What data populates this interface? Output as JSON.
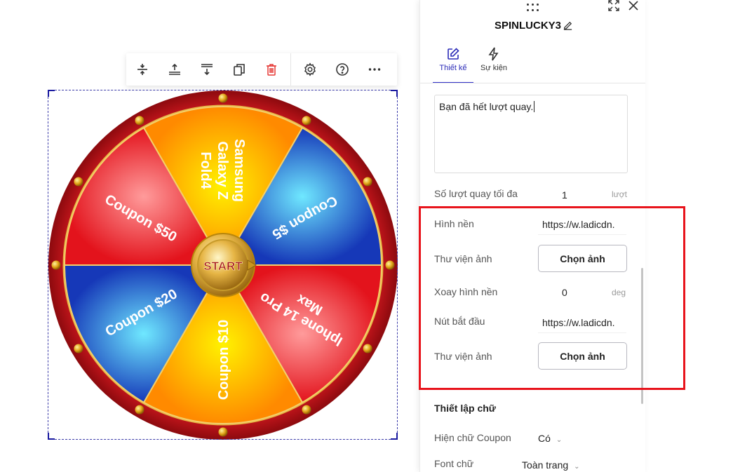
{
  "toolbar": {
    "icons": [
      "align-center-vertical-icon",
      "move-up-icon",
      "move-down-icon",
      "duplicate-icon",
      "delete-icon",
      "settings-icon",
      "help-icon",
      "more-icon"
    ]
  },
  "wheel": {
    "center_label": "START",
    "segments": [
      {
        "label": "Samsung Galaxy Z Fold4",
        "lines": [
          "Samsung",
          "Galaxy Z",
          "Fold4"
        ],
        "color": "#ff9800"
      },
      {
        "label": "Coupon $5",
        "lines": [
          "Coupon $5"
        ],
        "color": "#1e4fc4"
      },
      {
        "label": "Iphone 14 Pro Max",
        "lines": [
          "Iphone 14 Pro",
          "Max"
        ],
        "color": "#e8232a"
      },
      {
        "label": "Coupon $10",
        "lines": [
          "Coupon $10"
        ],
        "color": "#ff9800"
      },
      {
        "label": "Coupon $20",
        "lines": [
          "Coupon $20"
        ],
        "color": "#1e4fc4"
      },
      {
        "label": "Coupon $50",
        "lines": [
          "Coupon $50"
        ],
        "color": "#e8232a"
      }
    ],
    "rim_color": "#b4141a",
    "accent_color": "#e8a317"
  },
  "panel": {
    "title": "SPINLUCKY3",
    "tabs": [
      {
        "label": "Thiết kế",
        "icon": "edit-icon",
        "active": true
      },
      {
        "label": "Sự kiện",
        "icon": "lightning-icon",
        "active": false
      }
    ],
    "message_text": "Bạn đã hết lượt quay.",
    "max_spins": {
      "label": "Số lượt quay tối đa",
      "value": "1",
      "unit": "lượt"
    },
    "background": {
      "label": "Hình nền",
      "value": "https://w.ladicdn."
    },
    "background_library": {
      "label": "Thư viện ảnh",
      "button": "Chọn ảnh"
    },
    "rotate_background": {
      "label": "Xoay hình nền",
      "value": "0",
      "unit": "deg"
    },
    "start_button": {
      "label": "Nút bắt đầu",
      "value": "https://w.ladicdn."
    },
    "start_library": {
      "label": "Thư viện ảnh",
      "button": "Chọn ảnh"
    },
    "text_settings_title": "Thiết lập chữ",
    "show_coupon_text": {
      "label": "Hiện chữ Coupon",
      "value": "Có"
    },
    "font_text": {
      "label": "Font chữ",
      "value": "Toàn trang"
    }
  },
  "colors": {
    "highlight": "#e8141c",
    "active_tab": "#2b2bb8"
  }
}
